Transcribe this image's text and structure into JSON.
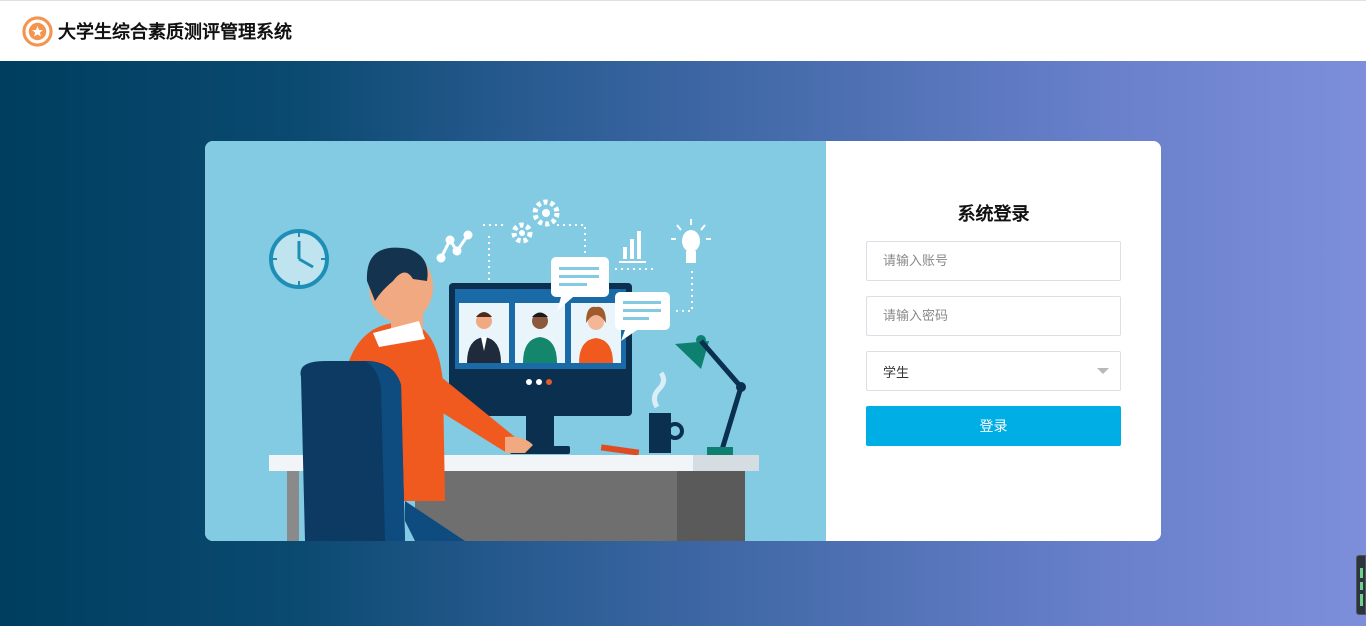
{
  "header": {
    "app_title": "大学生综合素质测评管理系统",
    "logo_icon": "star-badge-icon"
  },
  "login": {
    "title": "系统登录",
    "account_placeholder": "请输入账号",
    "password_placeholder": "请输入密码",
    "role_selected": "学生",
    "submit_label": "登录"
  },
  "colors": {
    "accent": "#00aee6",
    "logo": "#f5944e",
    "gradient_start": "#003e5f",
    "gradient_end": "#7d8fdb",
    "illustration_bg": "#83cbe3"
  }
}
